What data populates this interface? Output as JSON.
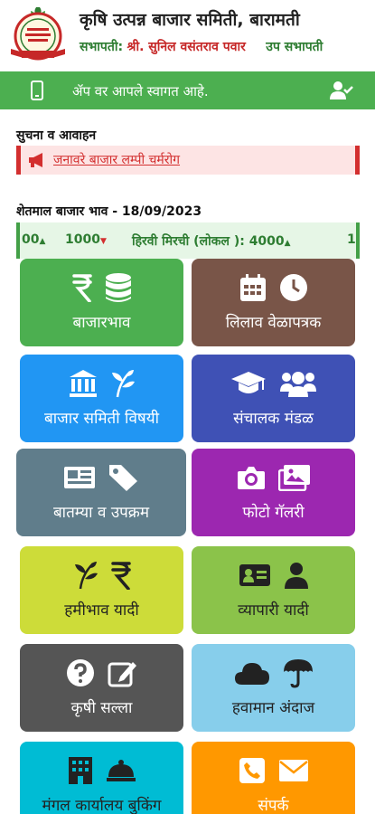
{
  "header": {
    "title": "कृषि उत्पन्न बाजार समिती, बारामती",
    "chairman_label": "सभापती:",
    "chairman_name": "श्री. सुनिल वसंतराव पवार",
    "vice_label": "उप सभापती"
  },
  "welcome": {
    "text": "ॲप वर आपले स्वागत आहे."
  },
  "notices": {
    "title": "सुचना व आवाहन",
    "item": "जनावरे बाजार लम्पी चर्मरोग"
  },
  "market": {
    "title": "शेतमाल बाजार भाव - 18/09/2023",
    "ticker": {
      "left_value": "00",
      "value2": "1000",
      "item": "हिरवी मिरची (लोकल ): 4000",
      "right_value": "1"
    }
  },
  "tiles": [
    {
      "label": "बाजारभाव",
      "color": "#4caf50",
      "icons": [
        "rupee-icon",
        "database-icon"
      ]
    },
    {
      "label": "लिलाव वेळापत्रक",
      "color": "#795548",
      "icons": [
        "calendar-icon",
        "clock-icon"
      ]
    },
    {
      "label": "बाजार समिती विषयी",
      "color": "#2196f3",
      "icons": [
        "bank-icon",
        "plant-icon"
      ]
    },
    {
      "label": "संचालक मंडळ",
      "color": "#3f51b5",
      "icons": [
        "graduation-cap-icon",
        "users-icon"
      ]
    },
    {
      "label": "बातम्या व उपक्रम",
      "color": "#607d8b",
      "icons": [
        "newspaper-icon",
        "tags-icon"
      ]
    },
    {
      "label": "फोटो गॅलरी",
      "color": "#9c27b0",
      "icons": [
        "camera-icon",
        "images-icon"
      ]
    },
    {
      "label": "हमीभाव यादी",
      "color": "#cddc39",
      "icons": [
        "plant-icon",
        "rupee-icon"
      ]
    },
    {
      "label": "व्यापारी यादी",
      "color": "#8bc34a",
      "icons": [
        "id-card-icon",
        "user-icon"
      ]
    },
    {
      "label": "कृषी सल्ला",
      "color": "#555555",
      "icons": [
        "question-icon",
        "edit-icon"
      ]
    },
    {
      "label": "हवामान अंदाज",
      "color": "#87ceeb",
      "icons": [
        "cloud-icon",
        "umbrella-icon"
      ]
    },
    {
      "label": "मंगल कार्यालय बुकिंग",
      "color": "#00bcd4",
      "icons": [
        "building-icon",
        "bell-icon"
      ]
    },
    {
      "label": "संपर्क",
      "color": "#ff9800",
      "icons": [
        "phone-icon",
        "envelope-icon"
      ]
    }
  ]
}
